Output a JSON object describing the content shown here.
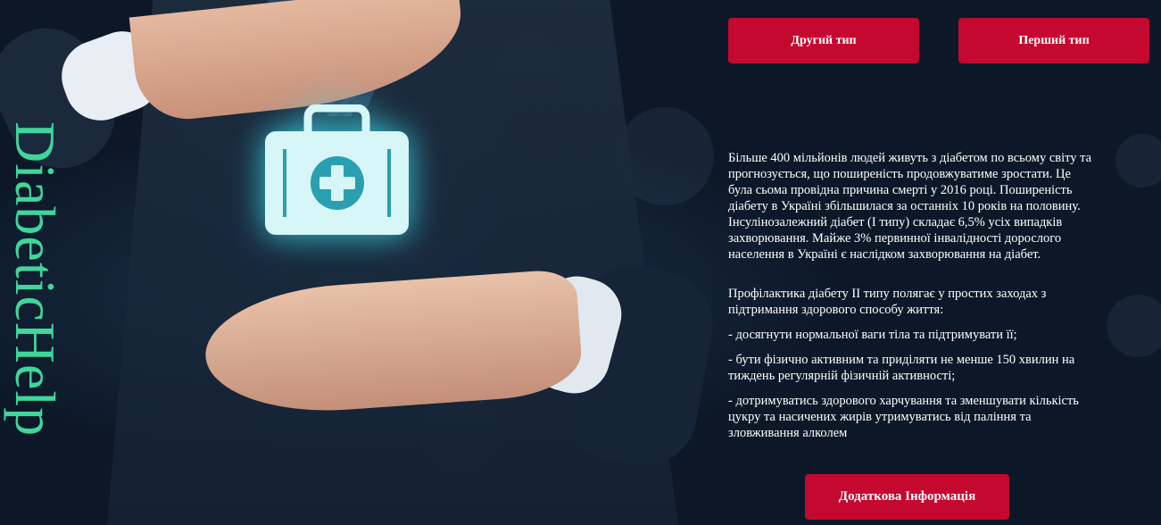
{
  "brand": {
    "name": "DiabeticHelp",
    "color": "#3fd69b"
  },
  "nav": {
    "type2_label": "Другий тип",
    "type1_label": "Перший тип"
  },
  "content": {
    "intro": "Більше 400 мільйонів людей живуть з діабетом по всьому світу та прогнозується, що поширеність продовжуватиме зростати. Це була сьома провідна причина смерті у 2016 році. Поширеність діабету в Україні збільшилася за останніх 10 років на половину. Інсулінозалежний діабет (І типу) складає 6,5% усіх випадків захворювання. Майже 3% первинної інвалідності дорослого населення в Україні є наслідком захворювання на діабет.",
    "prevention_heading": "Профілактика діабету ІІ типу полягає у простих заходах з підтримання здорового способу життя:",
    "items": [
      "- досягнути нормальної ваги тіла та підтримувати її;",
      "- бути фізично активним та приділяти не менше 150 хвилин на тиждень регулярній фізичній активності;",
      "- дотримуватись здорового харчування та зменшувати кількість цукру та насичених жирів утримуватись від паління та зловживання алколем"
    ]
  },
  "more_button": {
    "label": "Додаткова Інформація"
  },
  "colors": {
    "accent": "#c4082f",
    "text": "#ffffff",
    "glow": "#3ce0ea"
  },
  "hero": {
    "icon": "medical-kit-icon"
  }
}
